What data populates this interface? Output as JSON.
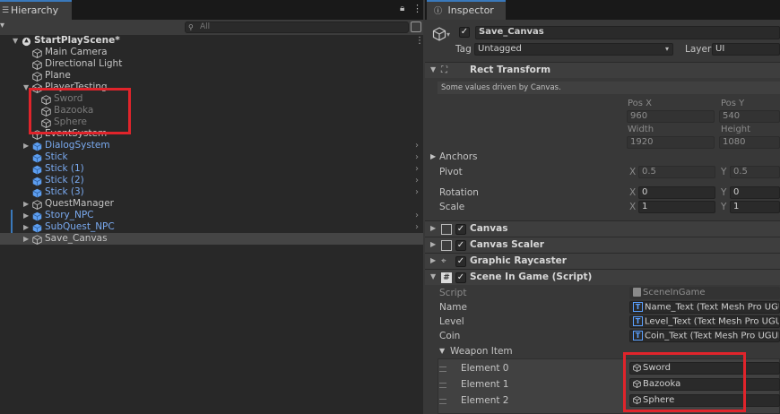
{
  "hierarchy": {
    "tab_title": "Hierarchy",
    "search_placeholder": "All",
    "rows": [
      {
        "label": "StartPlayScene*",
        "depth": 0,
        "arrow": "down",
        "style": "bold",
        "icon": "unity-scene-icon",
        "kebab": true
      },
      {
        "label": "Main Camera",
        "depth": 1,
        "arrow": "",
        "style": "normal",
        "icon": "cube-outline-icon"
      },
      {
        "label": "Directional Light",
        "depth": 1,
        "arrow": "",
        "style": "normal",
        "icon": "cube-outline-icon"
      },
      {
        "label": "Plane",
        "depth": 1,
        "arrow": "",
        "style": "normal",
        "icon": "cube-outline-icon"
      },
      {
        "label": "PlayerTesting",
        "depth": 1,
        "arrow": "down",
        "style": "normal",
        "icon": "cube-outline-icon"
      },
      {
        "label": "Sword",
        "depth": 2,
        "arrow": "",
        "style": "disabled",
        "icon": "cube-outline-icon"
      },
      {
        "label": "Bazooka",
        "depth": 2,
        "arrow": "",
        "style": "disabled",
        "icon": "cube-outline-icon"
      },
      {
        "label": "Sphere",
        "depth": 2,
        "arrow": "",
        "style": "disabled",
        "icon": "cube-outline-icon"
      },
      {
        "label": "EventSystem",
        "depth": 1,
        "arrow": "",
        "style": "normal",
        "icon": "cube-outline-icon"
      },
      {
        "label": "DialogSystem",
        "depth": 1,
        "arrow": "right",
        "style": "prefab",
        "icon": "prefab-cube-icon",
        "chevron": true
      },
      {
        "label": "Stick",
        "depth": 1,
        "arrow": "",
        "style": "prefab",
        "icon": "prefab-cube-icon",
        "chevron": true
      },
      {
        "label": "Stick (1)",
        "depth": 1,
        "arrow": "",
        "style": "prefab",
        "icon": "prefab-cube-icon",
        "chevron": true
      },
      {
        "label": "Stick (2)",
        "depth": 1,
        "arrow": "",
        "style": "prefab",
        "icon": "prefab-cube-icon",
        "chevron": true
      },
      {
        "label": "Stick (3)",
        "depth": 1,
        "arrow": "",
        "style": "prefab",
        "icon": "prefab-cube-icon",
        "chevron": true
      },
      {
        "label": "QuestManager",
        "depth": 1,
        "arrow": "right",
        "style": "normal",
        "icon": "cube-outline-icon"
      },
      {
        "label": "Story_NPC",
        "depth": 1,
        "arrow": "right",
        "style": "prefab",
        "icon": "prefab-cube-icon",
        "chevron": true,
        "blue_bar": true
      },
      {
        "label": "SubQuest_NPC",
        "depth": 1,
        "arrow": "right",
        "style": "prefab",
        "icon": "prefab-cube-icon",
        "chevron": true,
        "blue_bar": true
      },
      {
        "label": "Save_Canvas",
        "depth": 1,
        "arrow": "right",
        "style": "selected",
        "icon": "cube-outline-icon"
      }
    ]
  },
  "inspector": {
    "tab_title": "Inspector",
    "object_name": "Save_Canvas",
    "tag_label": "Tag",
    "tag_value": "Untagged",
    "layer_label": "Layer",
    "layer_value": "UI",
    "rect_transform": {
      "title": "Rect Transform",
      "note": "Some values driven by Canvas.",
      "pos_x_label": "Pos X",
      "pos_x": "960",
      "pos_y_label": "Pos Y",
      "pos_y": "540",
      "width_label": "Width",
      "width": "1920",
      "height_label": "Height",
      "height": "1080",
      "anchors_label": "Anchors",
      "pivot_label": "Pivot",
      "pivot_x": "0.5",
      "pivot_y": "0.5",
      "rotation_label": "Rotation",
      "rotation_x": "0",
      "rotation_y": "0",
      "scale_label": "Scale",
      "scale_x": "1",
      "scale_y": "1",
      "x_letter": "X",
      "y_letter": "Y"
    },
    "components": [
      "Canvas",
      "Canvas Scaler",
      "Graphic Raycaster"
    ],
    "script_component": {
      "title": "Scene In Game (Script)",
      "script_label": "Script",
      "script_value": "SceneInGame",
      "name_label": "Name",
      "name_value": "Name_Text (Text Mesh Pro UGUI)",
      "level_label": "Level",
      "level_value": "Level_Text (Text Mesh Pro UGUI)",
      "coin_label": "Coin",
      "coin_value": "Coin_Text (Text Mesh Pro UGUI)",
      "weapon_label": "Weapon Item",
      "elements": [
        {
          "label": "Element 0",
          "value": "Sword"
        },
        {
          "label": "Element 1",
          "value": "Bazooka"
        },
        {
          "label": "Element 2",
          "value": "Sphere"
        }
      ]
    }
  },
  "colors": {
    "accent_blue": "#3a79bb",
    "prefab_blue": "#7aaaf0",
    "highlight_red": "#e0242b"
  }
}
